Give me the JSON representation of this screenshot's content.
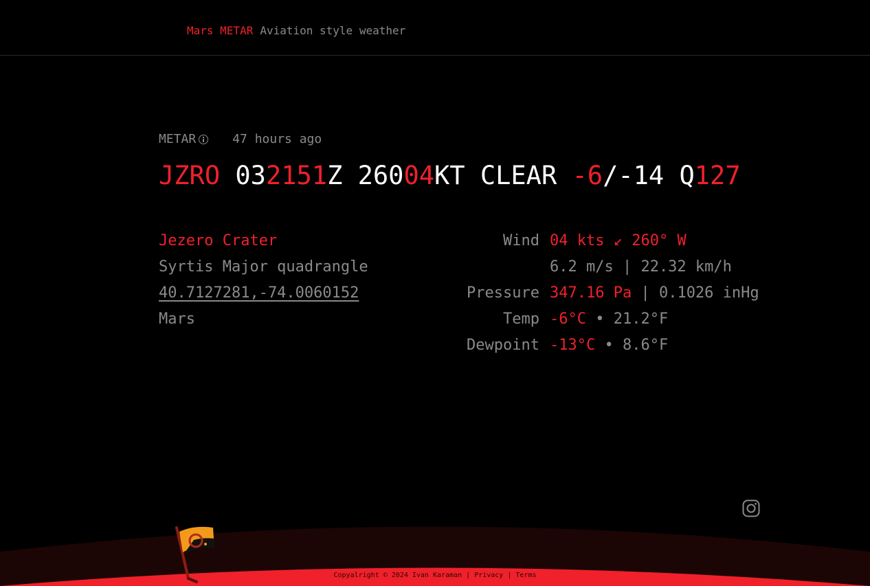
{
  "header": {
    "brand": "Mars METAR",
    "tagline": "Aviation style weather"
  },
  "meta": {
    "label": "METAR",
    "age": "47 hours ago"
  },
  "metar": {
    "station": "JZRO",
    "time_a": "03",
    "time_b": "2151",
    "time_c": "Z",
    "wind_a": "260",
    "wind_b": "04",
    "wind_c": "KT",
    "sky": "CLEAR",
    "temp": "-6",
    "dew": "/-14",
    "q_prefix": "Q",
    "q_value": "127"
  },
  "location": {
    "place": "Jezero Crater",
    "region": "Syrtis Major quadrangle",
    "coords": "40.7127281,-74.0060152",
    "planet": "Mars"
  },
  "readings": {
    "wind_label": "Wind",
    "wind_value": "04 kts ↙ 260° W",
    "wind_extra": "6.2 m/s | 22.32 km/h",
    "pressure_label": "Pressure",
    "pressure_value": "347.16 Pa",
    "pressure_extra": " | 0.1026 inHg",
    "temp_label": "Temp",
    "temp_value": "-6°C",
    "temp_extra": " • 21.2°F",
    "dew_label": "Dewpoint",
    "dew_value": "-13°C",
    "dew_extra": " • 8.6°F"
  },
  "footer": {
    "copyright": "Copyalright © 2024 Ivan Karaman",
    "sep1": " | ",
    "privacy": "Privacy",
    "sep2": " | ",
    "terms": "Terms"
  },
  "icons": {
    "info": "info-icon",
    "social": "instagram-icon",
    "flag": "rover-flag-icon"
  },
  "colors": {
    "accent": "#f0212b",
    "muted": "#8a8a8a",
    "background": "#000000",
    "ground_dark": "#1c0505"
  }
}
